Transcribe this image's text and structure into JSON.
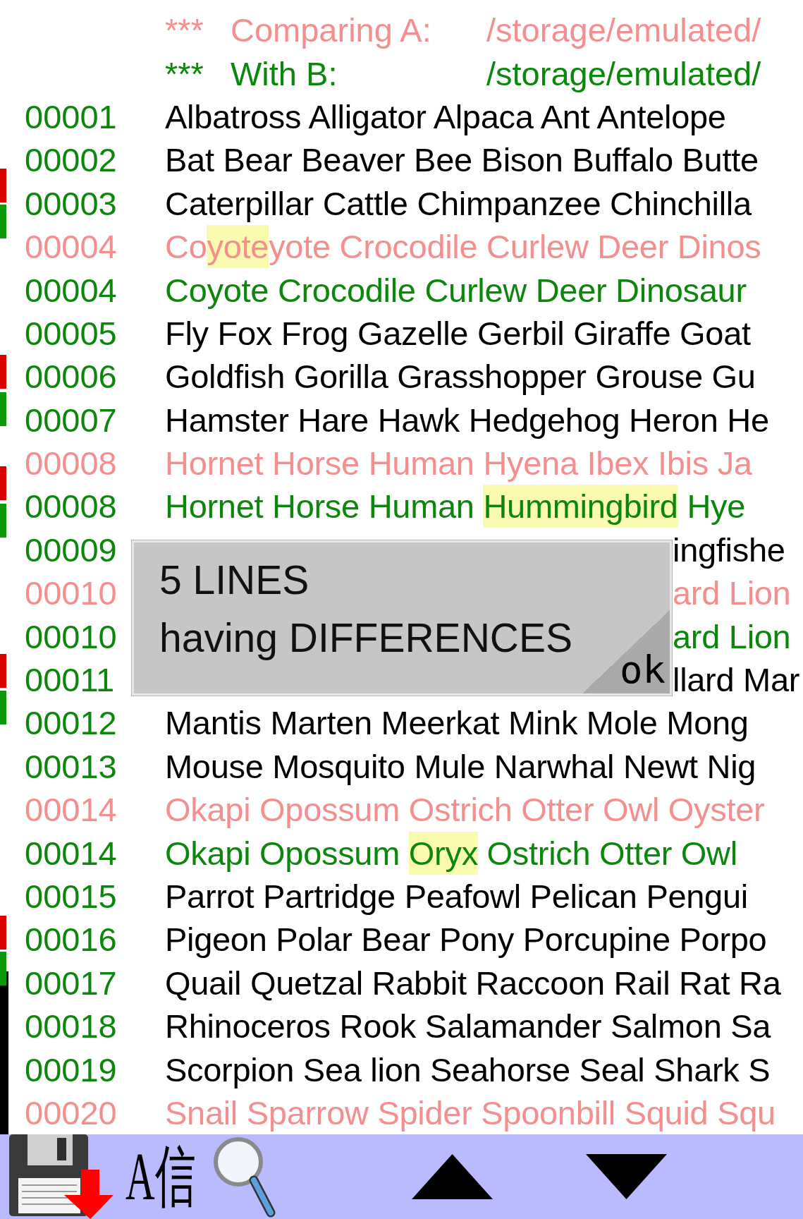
{
  "header": [
    {
      "kind": "a",
      "marker": "***",
      "label": "Comparing A:",
      "path": "/storage/emulated/"
    },
    {
      "kind": "b",
      "marker": "***",
      "label": "With B:",
      "path": "/storage/emulated/"
    }
  ],
  "lines": [
    {
      "number": "00001",
      "kind": "same",
      "covered": false,
      "segments": [
        {
          "text": "Albatross Alligator Alpaca Ant Antelope",
          "highlight": false
        }
      ]
    },
    {
      "number": "00002",
      "kind": "same",
      "covered": false,
      "segments": [
        {
          "text": "Bat Bear Beaver Bee Bison Buffalo Butte",
          "highlight": false
        }
      ]
    },
    {
      "number": "00003",
      "kind": "same",
      "covered": false,
      "segments": [
        {
          "text": "Caterpillar Cattle Chimpanzee Chinchilla",
          "highlight": false
        }
      ]
    },
    {
      "number": "00004",
      "kind": "a",
      "covered": false,
      "segments": [
        {
          "text": "Co",
          "highlight": false
        },
        {
          "text": "yote",
          "highlight": true
        },
        {
          "text": "yote Crocodile Curlew Deer Dinos",
          "highlight": false
        }
      ]
    },
    {
      "number": "00004",
      "kind": "b",
      "covered": false,
      "segments": [
        {
          "text": "Coyote Crocodile Curlew Deer Dinosaur",
          "highlight": false
        }
      ]
    },
    {
      "number": "00005",
      "kind": "same",
      "covered": false,
      "segments": [
        {
          "text": "Fly Fox Frog Gazelle Gerbil Giraffe Goat",
          "highlight": false
        }
      ]
    },
    {
      "number": "00006",
      "kind": "same",
      "covered": false,
      "segments": [
        {
          "text": "Goldfish Gorilla Grasshopper Grouse Gu",
          "highlight": false
        }
      ]
    },
    {
      "number": "00007",
      "kind": "same",
      "covered": false,
      "segments": [
        {
          "text": "Hamster Hare Hawk Hedgehog Heron He",
          "highlight": false
        }
      ]
    },
    {
      "number": "00008",
      "kind": "a",
      "covered": false,
      "segments": [
        {
          "text": "Hornet Horse Human Hyena Ibex Ibis Ja",
          "highlight": false
        }
      ]
    },
    {
      "number": "00008",
      "kind": "b",
      "covered": false,
      "segments": [
        {
          "text": "Hornet Horse Human ",
          "highlight": false
        },
        {
          "text": "Hummingbird",
          "highlight": true
        },
        {
          "text": " Hye",
          "highlight": false
        }
      ]
    },
    {
      "number": "00009",
      "kind": "same",
      "covered": true,
      "segments": [
        {
          "text": "ingfishe",
          "highlight": false
        }
      ]
    },
    {
      "number": "00010",
      "kind": "a",
      "covered": true,
      "segments": [
        {
          "text": "ard Lion",
          "highlight": false
        }
      ]
    },
    {
      "number": "00010",
      "kind": "b",
      "covered": true,
      "segments": [
        {
          "text": "ard Lion",
          "highlight": false
        }
      ]
    },
    {
      "number": "00011",
      "kind": "same",
      "covered": true,
      "segments": [
        {
          "text": "llard Mar",
          "highlight": false
        }
      ]
    },
    {
      "number": "00012",
      "kind": "same",
      "covered": false,
      "segments": [
        {
          "text": "Mantis Marten Meerkat Mink Mole Mong",
          "highlight": false
        }
      ]
    },
    {
      "number": "00013",
      "kind": "same",
      "covered": false,
      "segments": [
        {
          "text": "Mouse Mosquito Mule Narwhal Newt Nig",
          "highlight": false
        }
      ]
    },
    {
      "number": "00014",
      "kind": "a",
      "covered": false,
      "segments": [
        {
          "text": "Okapi Opossum Ostrich Otter Owl Oyster",
          "highlight": false
        }
      ]
    },
    {
      "number": "00014",
      "kind": "b",
      "covered": false,
      "segments": [
        {
          "text": "Okapi Opossum ",
          "highlight": false
        },
        {
          "text": "Oryx",
          "highlight": true
        },
        {
          "text": " Ostrich Otter Owl",
          "highlight": false
        }
      ]
    },
    {
      "number": "00015",
      "kind": "same",
      "covered": false,
      "segments": [
        {
          "text": "Parrot Partridge Peafowl Pelican Pengui",
          "highlight": false
        }
      ]
    },
    {
      "number": "00016",
      "kind": "same",
      "covered": false,
      "segments": [
        {
          "text": "Pigeon Polar Bear Pony Porcupine Porpo",
          "highlight": false
        }
      ]
    },
    {
      "number": "00017",
      "kind": "same",
      "covered": false,
      "segments": [
        {
          "text": "Quail Quetzal Rabbit Raccoon Rail Rat Ra",
          "highlight": false
        }
      ]
    },
    {
      "number": "00018",
      "kind": "same",
      "covered": false,
      "segments": [
        {
          "text": "Rhinoceros Rook Salamander Salmon Sa",
          "highlight": false
        }
      ]
    },
    {
      "number": "00019",
      "kind": "same",
      "covered": false,
      "segments": [
        {
          "text": "Scorpion Sea lion Seahorse Seal Shark S",
          "highlight": false
        }
      ]
    },
    {
      "number": "00020",
      "kind": "a",
      "covered": false,
      "segments": [
        {
          "text": "Snail Sparrow Spider Spoonbill Squid Squ",
          "highlight": false
        }
      ]
    }
  ],
  "overview": {
    "marks": [
      {
        "kind": "a"
      },
      {
        "kind": "b"
      },
      {
        "kind": "a"
      },
      {
        "kind": "b"
      },
      {
        "kind": "a"
      },
      {
        "kind": "b"
      },
      {
        "kind": "a"
      },
      {
        "kind": "b"
      },
      {
        "kind": "a"
      },
      {
        "kind": "b"
      }
    ]
  },
  "dialog": {
    "message": [
      "5 LINES",
      "having DIFFERENCES"
    ],
    "button": "ok"
  },
  "toolbar": {
    "items": [
      {
        "kind": "save"
      },
      {
        "kind": "encoding",
        "label": "A信"
      },
      {
        "kind": "search"
      },
      {
        "kind": "up"
      },
      {
        "kind": "down"
      }
    ]
  }
}
